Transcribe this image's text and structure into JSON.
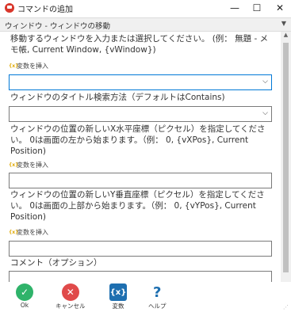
{
  "window": {
    "title": "コマンドの追加",
    "minimize": "—",
    "maximize": "☐",
    "close": "✕"
  },
  "action_selector": {
    "value": "ウィンドウ - ウィンドウの移動",
    "arrow": "▼"
  },
  "fields": {
    "window": {
      "label": "移動するウィンドウを入力または選択してください。 (例： 無題 - メモ帳, Current Window, {vWindow})",
      "variable_link": "変数を挿入",
      "value": ""
    },
    "search_method": {
      "label": "ウィンドウのタイトル検索方法（デフォルトはContains)",
      "value": ""
    },
    "x_position": {
      "label": "ウィンドウの位置の新しいX水平座標（ピクセル）を指定してください。 0は画面の左から始まります。（例： 0, {vXPos}, Current Position)",
      "variable_link": "変数を挿入",
      "value": ""
    },
    "y_position": {
      "label": "ウィンドウの位置の新しいY垂直座標（ピクセル）を指定してください。 0は画面の上部から始まります。（例： 0, {vYPos}, Current Position)",
      "variable_link": "変数を挿入",
      "value": ""
    },
    "comment": {
      "label": "コメント（オプション）"
    }
  },
  "footer": {
    "ok_label": "Ok",
    "cancel_label": "キャンセル",
    "variables_label": "変数",
    "variables_glyph": "{x}",
    "help_label": "ヘルプ",
    "help_glyph": "?"
  }
}
